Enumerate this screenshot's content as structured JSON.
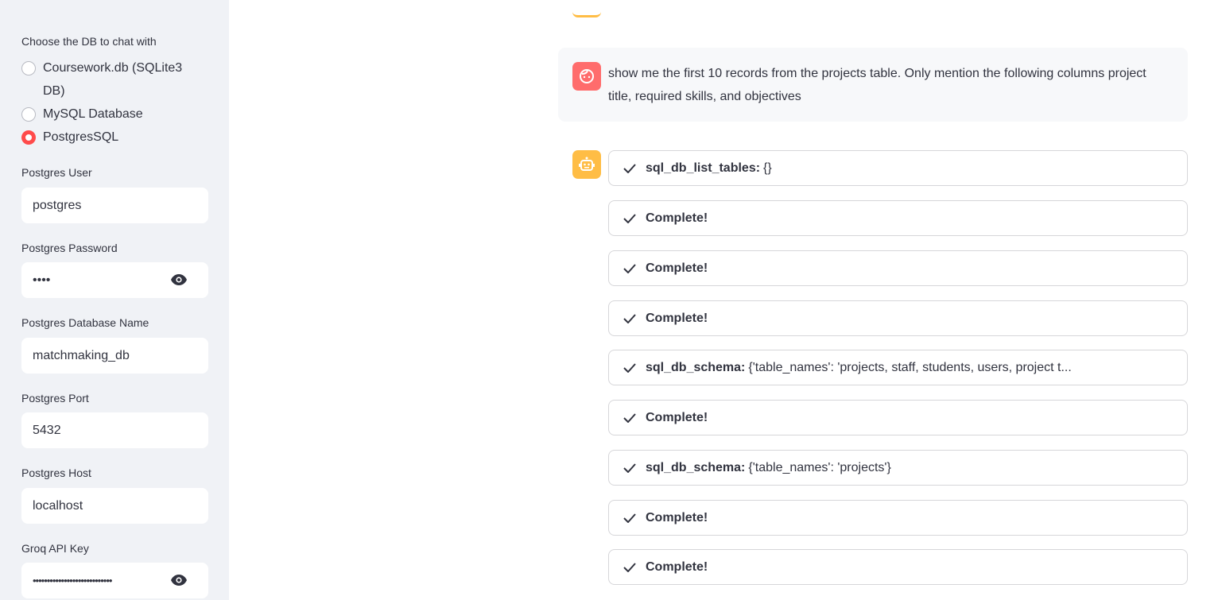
{
  "sidebar": {
    "radio_label": "Choose the DB to chat with",
    "options": [
      "Coursework.db (SQLite3 DB)",
      "MySQL Database",
      "PostgresSQL"
    ],
    "selected": "PostgresSQL",
    "fields": [
      {
        "label": "Postgres User",
        "value": "postgres"
      },
      {
        "label": "Postgres Password",
        "value": "••••"
      },
      {
        "label": "Postgres Database Name",
        "value": "matchmaking_db"
      },
      {
        "label": "Postgres Port",
        "value": "5432"
      },
      {
        "label": "Postgres Host",
        "value": "localhost"
      },
      {
        "label": "Groq API Key",
        "value": "••••••••••••••••••••••••••••"
      }
    ]
  },
  "chat": {
    "user_message": "show me the first 10 records from the projects table. Only mention the following columns project title, required skills, and objectives",
    "steps": [
      {
        "name": "sql_db_list_tables:",
        "arg": "{}"
      },
      {
        "name": "Complete!",
        "arg": ""
      },
      {
        "name": "Complete!",
        "arg": ""
      },
      {
        "name": "Complete!",
        "arg": ""
      },
      {
        "name": "sql_db_schema:",
        "arg": "{'table_names': 'projects, staff, students, users, project t..."
      },
      {
        "name": "Complete!",
        "arg": ""
      },
      {
        "name": "sql_db_schema:",
        "arg": "{'table_names': 'projects'}"
      },
      {
        "name": "Complete!",
        "arg": ""
      },
      {
        "name": "Complete!",
        "arg": ""
      }
    ]
  },
  "colors": {
    "accent": "#ff4b4b",
    "user_avatar": "#ff6c6c",
    "bot_avatar": "#ffbd45",
    "sidebar": "#f0f2f6"
  }
}
